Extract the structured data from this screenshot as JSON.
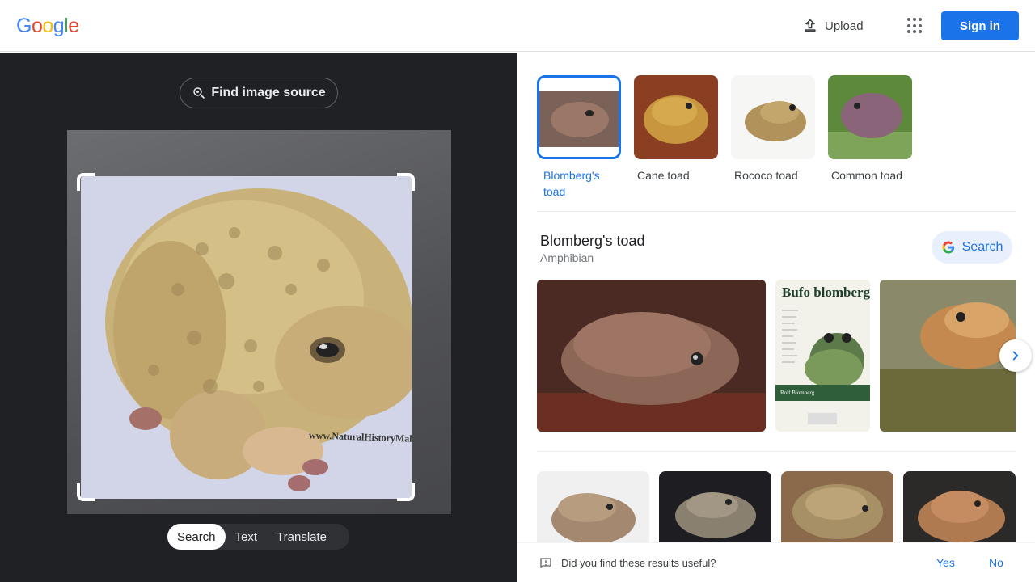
{
  "header": {
    "logo": [
      "G",
      "o",
      "o",
      "g",
      "l",
      "e"
    ],
    "logo_colors": [
      "#4285f4",
      "#ea4335",
      "#fbbc05",
      "#4285f4",
      "#34a853",
      "#ea4335"
    ],
    "upload_label": "Upload",
    "signin_label": "Sign in"
  },
  "left": {
    "find_source_label": "Find image source",
    "watermark": "www.NaturalHistoryMall.com",
    "modes": [
      "Search",
      "Text",
      "Translate"
    ],
    "active_mode": "Search"
  },
  "matches": [
    {
      "label": "Blomberg's toad",
      "selected": true
    },
    {
      "label": "Cane toad",
      "selected": false
    },
    {
      "label": "Rococo toad",
      "selected": false
    },
    {
      "label": "Common toad",
      "selected": false
    }
  ],
  "entity": {
    "title": "Blomberg's toad",
    "subtitle": "Amphibian",
    "search_label": "Search"
  },
  "gallery": {
    "book_title": "Bufo blomberg",
    "book_author": "Rolf Blomberg"
  },
  "feedback": {
    "question": "Did you find these results useful?",
    "yes": "Yes",
    "no": "No"
  },
  "colors": {
    "accent": "#1a73e8",
    "dark_panel": "#202124"
  }
}
